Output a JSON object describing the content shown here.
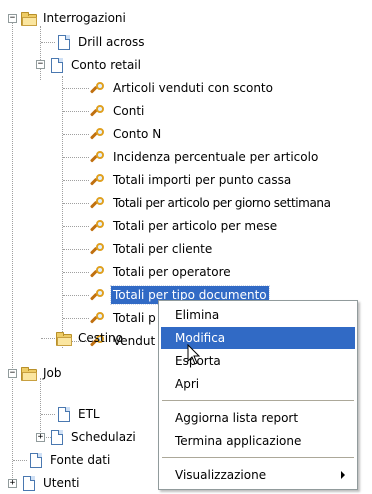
{
  "tree": {
    "interrogazioni": "Interrogazioni",
    "drill_across": "Drill across",
    "conto_retail": "Conto retail",
    "reports": [
      "Articoli venduti con sconto",
      "Conti",
      "Conto N",
      "Incidenza percentuale per articolo",
      "Totali importi per punto cassa",
      "Totali per articolo per giorno settimana",
      "Totali per articolo per mese",
      "Totali per cliente",
      "Totali per operatore",
      "Totali per tipo documento",
      "Totali p",
      "Vendut"
    ],
    "cestino": "Cestino",
    "job": "Job",
    "etl": "ETL",
    "schedulazioni": "Schedulazi",
    "fonte_dati": "Fonte dati",
    "utenti": "Utenti",
    "expander_open": "−",
    "expander_closed": "+"
  },
  "context_menu": {
    "items": [
      "Elimina",
      "Modifica",
      "Esporta",
      "Apri",
      "Aggiorna lista report",
      "Termina applicazione",
      "Visualizzazione"
    ],
    "highlighted": "Modifica"
  },
  "colors": {
    "selection": "#316ac5",
    "folder": "#eecc66"
  }
}
